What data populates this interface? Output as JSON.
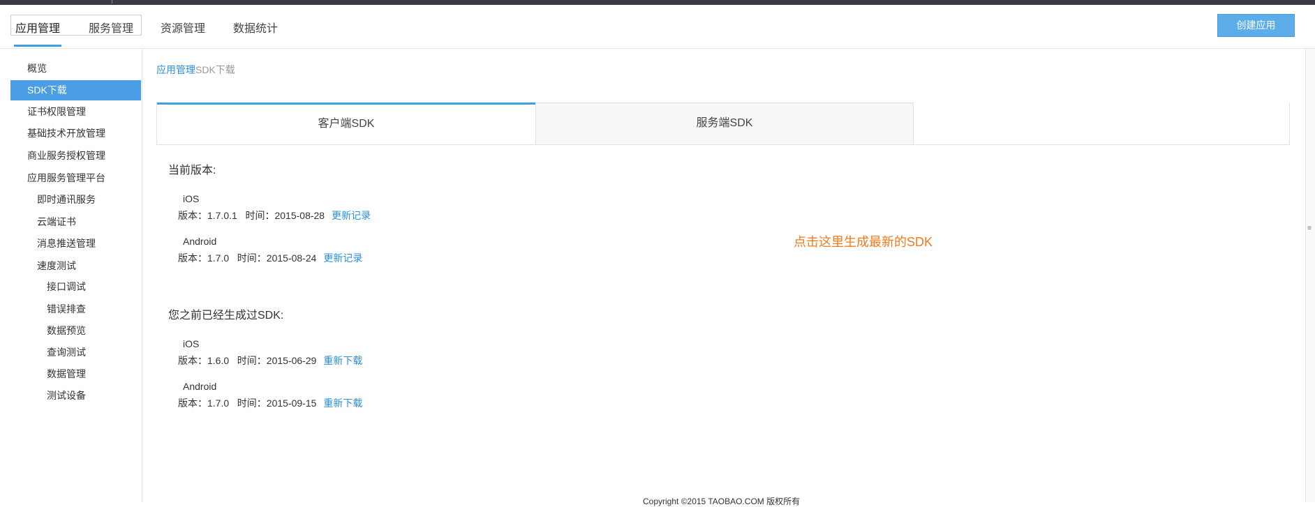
{
  "nav": {
    "tabs": [
      "应用管理",
      "服务管理",
      "资源管理",
      "数据统计"
    ],
    "create_button": "创建应用"
  },
  "sidebar": {
    "items": [
      {
        "label": "概览",
        "level": 1,
        "active": false
      },
      {
        "label": "SDK下载",
        "level": 1,
        "active": true
      },
      {
        "label": "证书权限管理",
        "level": 1,
        "active": false
      },
      {
        "label": "基础技术开放管理",
        "level": 1,
        "active": false
      },
      {
        "label": "商业服务授权管理",
        "level": 1,
        "active": false
      },
      {
        "label": "应用服务管理平台",
        "level": 1,
        "active": false
      },
      {
        "label": "即时通讯服务",
        "level": 2,
        "active": false
      },
      {
        "label": "云端证书",
        "level": 2,
        "active": false
      },
      {
        "label": "消息推送管理",
        "level": 2,
        "active": false
      },
      {
        "label": "速度测试",
        "level": 2,
        "active": false
      },
      {
        "label": "接口调试",
        "level": 3,
        "active": false
      },
      {
        "label": "错误排查",
        "level": 3,
        "active": false
      },
      {
        "label": "数据预览",
        "level": 3,
        "active": false
      },
      {
        "label": "查询测试",
        "level": 3,
        "active": false
      },
      {
        "label": "数据管理",
        "level": 3,
        "active": false
      },
      {
        "label": "测试设备",
        "level": 3,
        "active": false
      }
    ]
  },
  "breadcrumb": {
    "link": "应用管理",
    "current": "SDK下载"
  },
  "tabs": {
    "client": "客户端SDK",
    "server": "服务端SDK"
  },
  "current": {
    "title": "当前版本:",
    "entries": [
      {
        "platform": "iOS",
        "info": "版本：1.7.0.1   时间：2015-08-28",
        "link": "更新记录"
      },
      {
        "platform": "Android",
        "info": "版本：1.7.0   时间：2015-08-24",
        "link": "更新记录"
      }
    ]
  },
  "generate_link": "点击这里生成最新的SDK",
  "previous": {
    "title": "您之前已经生成过SDK:",
    "entries": [
      {
        "platform": "iOS",
        "info": "版本：1.6.0   时间：2015-06-29",
        "link": "重新下载"
      },
      {
        "platform": "Android",
        "info": "版本：1.7.0   时间：2015-09-15",
        "link": "重新下载"
      }
    ]
  },
  "footer": "Copyright ©2015 TAOBAO.COM 版权所有",
  "colors": {
    "accent": "#3f9fe0",
    "active_bg": "#4a9ee6",
    "link": "#2a8fd8",
    "orange": "#f07a1e",
    "topbar": "#3a3c44"
  }
}
